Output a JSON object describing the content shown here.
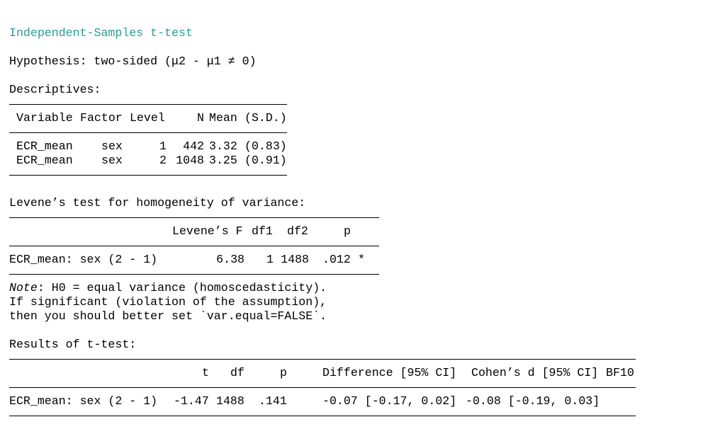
{
  "title": "Independent-Samples t-test",
  "hypothesis": "Hypothesis: two-sided (μ2 - μ1 ≠ 0)",
  "descriptives": {
    "heading": "Descriptives:",
    "headers": {
      "variable": "Variable",
      "factor": "Factor",
      "level": "Level",
      "n": "N",
      "mean": "Mean",
      "sd": "(S.D.)"
    },
    "rows": [
      {
        "variable": "ECR_mean",
        "factor": "sex",
        "level": "1",
        "n": "442",
        "mean": "3.32",
        "sd": "(0.83)"
      },
      {
        "variable": "ECR_mean",
        "factor": "sex",
        "level": "2",
        "n": "1048",
        "mean": "3.25",
        "sd": "(0.91)"
      }
    ]
  },
  "levene": {
    "heading": "Levene’s test for homogeneity of variance:",
    "headers": {
      "f": "Levene’s F",
      "df1": "df1",
      "df2": "df2",
      "p": "p"
    },
    "row": {
      "label": "ECR_mean: sex (2 - 1)",
      "f": "6.38",
      "df1": "1",
      "df2": "1488",
      "p": ".012",
      "sig": "*"
    },
    "note": {
      "prefix": "Note",
      "line1": ": H0 = equal variance (homoscedasticity).",
      "line2": "If significant (violation of the assumption),",
      "line3": "then you should better set `var.equal=FALSE`."
    }
  },
  "ttest": {
    "heading": "Results of t-test:",
    "headers": {
      "t": "t",
      "df": "df",
      "p": "p",
      "diff": "Difference [95% CI]",
      "d": "Cohen’s d [95% CI]",
      "bf": "BF10"
    },
    "row": {
      "label": "ECR_mean: sex (2 - 1)",
      "t": "-1.47",
      "df": "1488",
      "p": ".141",
      "diff": "-0.07 [-0.17, 0.02]",
      "d": "-0.08 [-0.19, 0.03]",
      "bf": ""
    }
  }
}
